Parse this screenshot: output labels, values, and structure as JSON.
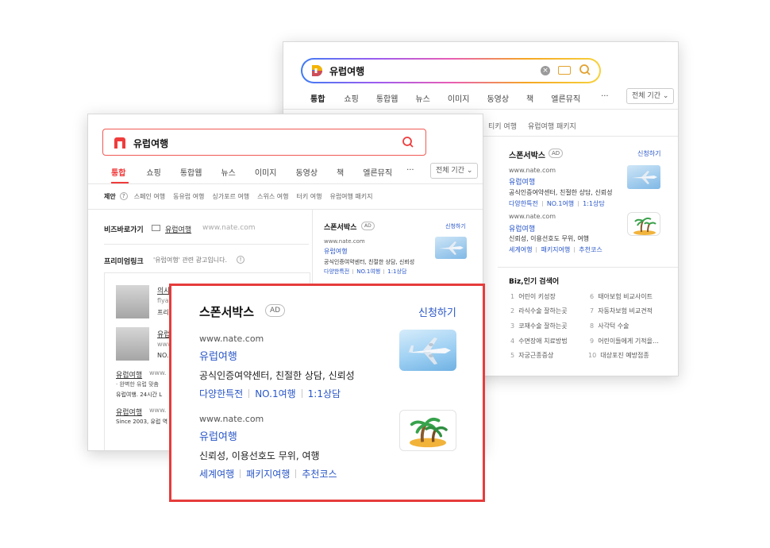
{
  "daum": {
    "query": "유럽여행",
    "tabs": [
      "통합",
      "쇼핑",
      "통합웹",
      "뉴스",
      "이미지",
      "동영상",
      "책",
      "엘른뮤직"
    ],
    "more": "···",
    "period": "전체 기간",
    "related": [
      "티키 여행",
      "유럽여행 패키지"
    ],
    "sponsor": {
      "title": "스폰서박스",
      "ad": "AD",
      "apply": "신청하기",
      "ads": [
        {
          "url": "www.nate.com",
          "title": "유럽여행",
          "desc": "공식인증여약센터, 친절한 상담, 신뢰성",
          "links": [
            "다양한특전",
            "NO.1여행",
            "1:1상담"
          ]
        },
        {
          "url": "www.nate.com",
          "title": "유럽여행",
          "desc": "신뢰성, 이용선호도 무위, 여행",
          "links": [
            "세계여행",
            "패키지여행",
            "추천코스"
          ]
        }
      ]
    },
    "popular": {
      "title": "Biz,인기 검색어",
      "items": [
        {
          "rank": "1",
          "text": "어린이 키성장"
        },
        {
          "rank": "2",
          "text": "라식수술 잘하는곳"
        },
        {
          "rank": "3",
          "text": "코재수술 잘하는곳"
        },
        {
          "rank": "4",
          "text": "수면장애 치료방법"
        },
        {
          "rank": "5",
          "text": "자궁근종증상"
        },
        {
          "rank": "6",
          "text": "태아보험 비교사이트"
        },
        {
          "rank": "7",
          "text": "자동차보험 비교견적"
        },
        {
          "rank": "8",
          "text": "사각턱 수술"
        },
        {
          "rank": "9",
          "text": "어린이들에게 기적을…"
        },
        {
          "rank": "10",
          "text": "대상포진 예방접종"
        }
      ]
    }
  },
  "nate": {
    "query": "유럽여행",
    "tabs": [
      "통합",
      "쇼핑",
      "통합웹",
      "뉴스",
      "이미지",
      "동영상",
      "책",
      "엘른뮤직"
    ],
    "more": "···",
    "period": "전체 기간",
    "suggest_label": "제안",
    "suggest_help": "?",
    "suggestions": [
      "스페인 여행",
      "동유럽 여행",
      "싱가포르 여행",
      "스위스 여행",
      "터키 여행",
      "유럽여행 패키지"
    ],
    "bizlink": {
      "label": "비즈바로가기",
      "link": "유럽여행",
      "url": "www.nate.com"
    },
    "premium": {
      "title": "프리미엄링크",
      "note": "'유럽여행' 관련 광고입니다."
    },
    "results": [
      {
        "title": "의사",
        "sub": "flya",
        "desc": "프리"
      },
      {
        "title": "유럽",
        "sub": "www",
        "desc": "NO.1"
      }
    ],
    "extra": [
      {
        "title": "유럽여행",
        "url": "www.",
        "desc": "· 완벽한 유럽 맞춤",
        "desc2": "유럽여행. 24시간 L"
      },
      {
        "title": "유럽여행",
        "url": "www.",
        "desc": "Since 2003, 유럽 역"
      }
    ],
    "sponsor": {
      "title": "스폰서박스",
      "ad": "AD",
      "apply": "신청하기",
      "url": "www.nate.com",
      "item_title": "유럽여행",
      "desc": "공식인증여약센터, 친절한 상담, 신뢰성",
      "links": [
        "다양한특전",
        "NO.1여행",
        "1:1상담"
      ]
    }
  },
  "popup": {
    "title": "스폰서박스",
    "ad": "AD",
    "apply": "신청하기",
    "ads": [
      {
        "url": "www.nate.com",
        "title": "유럽여행",
        "desc": "공식인증여약센터, 친절한 상담, 신뢰성",
        "links": [
          "다양한특전",
          "NO.1여행",
          "1:1상담"
        ],
        "image": "airplane-image"
      },
      {
        "url": "www.nate.com",
        "title": "유럽여행",
        "desc": "신뢰성, 이용선호도 무위, 여행",
        "links": [
          "세계여행",
          "패키지여행",
          "추천코스"
        ],
        "image": "palm-island-image"
      }
    ]
  },
  "colors": {
    "accent_red": "#e63c3c",
    "link_blue": "#2956c8",
    "nate_red": "#f03c3c"
  }
}
